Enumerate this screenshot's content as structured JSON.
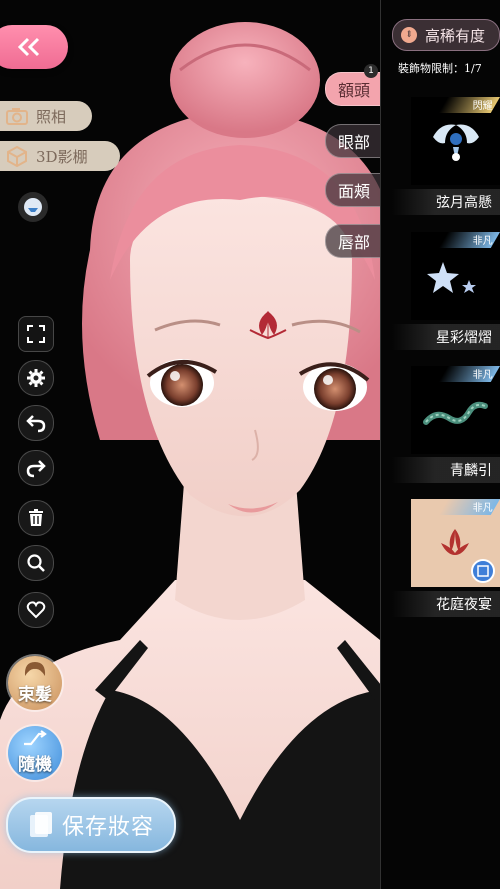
{
  "left_controls": {
    "back_icon": "double-chevron-left-icon",
    "photo_label": "照相",
    "studio_label": "3D影棚",
    "tools": [
      "fullscreen-icon",
      "gear-icon",
      "undo-icon",
      "redo-icon",
      "trash-icon",
      "zoom-icon",
      "heart-icon"
    ]
  },
  "hair_button": {
    "label": "束髮"
  },
  "random_button": {
    "label": "隨機"
  },
  "save_button": {
    "label": "保存妝容"
  },
  "tabs": [
    {
      "label": "額頭",
      "active": true,
      "badge": "1"
    },
    {
      "label": "眼部",
      "active": false
    },
    {
      "label": "面頰",
      "active": false
    },
    {
      "label": "唇部",
      "active": false
    }
  ],
  "sort": {
    "label": "高稀有度"
  },
  "accessory_limit": "裝飾物限制：1/7",
  "items": [
    {
      "name": "弦月高懸",
      "rarity": "閃耀",
      "rarity_color": "#e8c872"
    },
    {
      "name": "星彩熠熠",
      "rarity": "非凡",
      "rarity_color": "#7db7e6"
    },
    {
      "name": "青麟引",
      "rarity": "非凡",
      "rarity_color": "#7db7e6"
    },
    {
      "name": "花庭夜宴",
      "rarity": "非凡",
      "rarity_color": "#7db7e6"
    }
  ],
  "colors": {
    "accent_pink": "#f06c93",
    "save_blue": "#86b7de",
    "hair": "#f29aa8"
  }
}
